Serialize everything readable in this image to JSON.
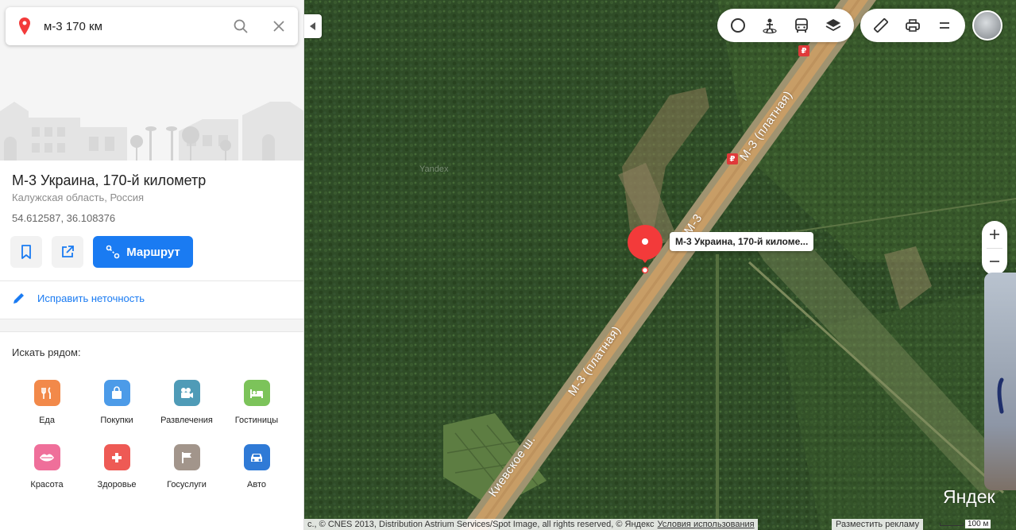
{
  "search": {
    "query": "м-3 170 км"
  },
  "place": {
    "title": "М-3 Украина, 170-й километр",
    "region": "Калужская область, Россия",
    "coords": "54.612587, 36.108376",
    "route_label": "Маршрут",
    "fix_label": "Исправить неточность"
  },
  "nearby": {
    "label": "Искать рядом:",
    "categories": [
      {
        "label": "Еда",
        "icon": "fork-knife-icon",
        "color": "#f2894a"
      },
      {
        "label": "Покупки",
        "icon": "shopping-bag-icon",
        "color": "#4c9be8"
      },
      {
        "label": "Развлечения",
        "icon": "camera-icon",
        "color": "#4f9bb7"
      },
      {
        "label": "Гостиницы",
        "icon": "bed-icon",
        "color": "#7cc35a"
      },
      {
        "label": "Красота",
        "icon": "lips-icon",
        "color": "#ef6f9a"
      },
      {
        "label": "Здоровье",
        "icon": "medical-cross-icon",
        "color": "#ee5a55"
      },
      {
        "label": "Госуслуги",
        "icon": "flag-icon",
        "color": "#a2958b"
      },
      {
        "label": "Авто",
        "icon": "car-icon",
        "color": "#2f7ad6"
      }
    ]
  },
  "map": {
    "pin_label": "М-3 Украина, 170-й киломе...",
    "road_labels": [
      "М-3 (платная)",
      "М-3",
      "М-3 (платная)",
      "Киевское ш."
    ],
    "logo": "Яндек",
    "copyright": "с., © CNES 2013, Distribution Astrium Services/Spot Image, all rights reserved, © Яндекс",
    "terms": "Условия использования",
    "ad": "Разместить рекламу",
    "scale": "100 м",
    "watermark": "Yandex",
    "toll_sign": "₽"
  },
  "colors": {
    "accent": "#1a7bf2",
    "pin": "#f33a3a"
  }
}
